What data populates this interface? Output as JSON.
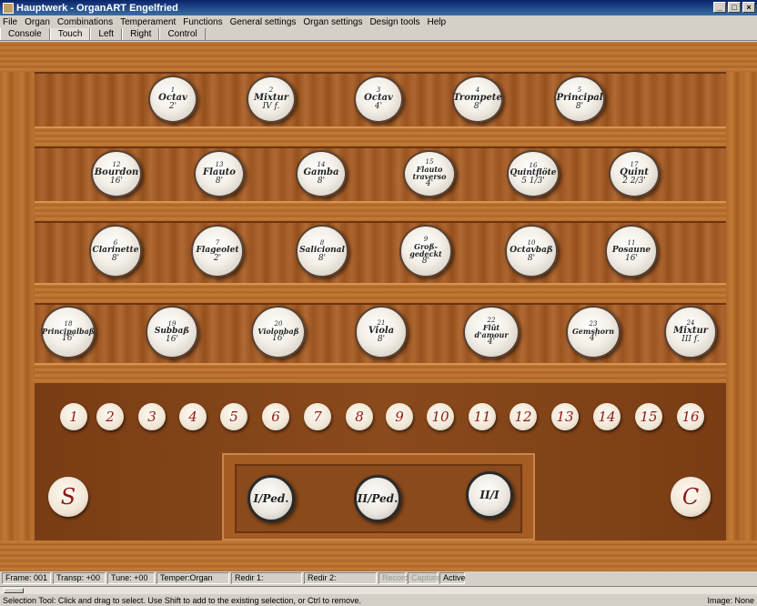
{
  "window": {
    "title": "Hauptwerk - OrganART Engelfried"
  },
  "menu": [
    "File",
    "Organ",
    "Combinations",
    "Temperament",
    "Functions",
    "General settings",
    "Organ settings",
    "Design tools",
    "Help"
  ],
  "tabs": [
    "Console",
    "Touch",
    "Left",
    "Right",
    "Control"
  ],
  "stops": [
    {
      "num": "1",
      "name": "Octav",
      "pitch": "2'"
    },
    {
      "num": "2",
      "name": "Mixtur",
      "pitch": "IV f."
    },
    {
      "num": "3",
      "name": "Octav",
      "pitch": "4'"
    },
    {
      "num": "4",
      "name": "Trompete",
      "pitch": "8'"
    },
    {
      "num": "5",
      "name": "Principal",
      "pitch": "8'"
    },
    {
      "num": "12",
      "name": "Bourdon",
      "pitch": "16'"
    },
    {
      "num": "13",
      "name": "Flauto",
      "pitch": "8'"
    },
    {
      "num": "14",
      "name": "Gamba",
      "pitch": "8'"
    },
    {
      "num": "15",
      "name": "Flauto traverso",
      "pitch": "4'"
    },
    {
      "num": "16",
      "name": "Quintflöte",
      "pitch": "5 1/3'"
    },
    {
      "num": "17",
      "name": "Quint",
      "pitch": "2 2/3'"
    },
    {
      "num": "6",
      "name": "Clarinette",
      "pitch": "8'"
    },
    {
      "num": "7",
      "name": "Flageolet",
      "pitch": "2'"
    },
    {
      "num": "8",
      "name": "Salicional",
      "pitch": "8'"
    },
    {
      "num": "9",
      "name": "Groß-gedeckt",
      "pitch": "8'"
    },
    {
      "num": "10",
      "name": "Octavbaß",
      "pitch": "8'"
    },
    {
      "num": "11",
      "name": "Posaune",
      "pitch": "16'"
    },
    {
      "num": "18",
      "name": "Principalbaß",
      "pitch": "16'"
    },
    {
      "num": "19",
      "name": "Subbaß",
      "pitch": "16'"
    },
    {
      "num": "20",
      "name": "Violonbaß",
      "pitch": "16'"
    },
    {
      "num": "21",
      "name": "Viola",
      "pitch": "8'"
    },
    {
      "num": "22",
      "name": "Flût d'amour",
      "pitch": "4'"
    },
    {
      "num": "23",
      "name": "Gemshorn",
      "pitch": "4'"
    },
    {
      "num": "24",
      "name": "Mixtur",
      "pitch": "III f."
    }
  ],
  "pistons": [
    "1",
    "2",
    "3",
    "4",
    "5",
    "6",
    "7",
    "8",
    "9",
    "10",
    "11",
    "12",
    "13",
    "14",
    "15",
    "16"
  ],
  "set_piston": "S",
  "cancel_piston": "C",
  "couplers": [
    "I/Ped.",
    "II/Ped.",
    "II/I"
  ],
  "status": {
    "frame": "Frame: 001",
    "transp": "Transp: +00",
    "tune": "Tune: +00",
    "temper": "Temper:Organ",
    "redir1": "Redir 1:",
    "redir2": "Redir 2:",
    "record": "Record",
    "capture": "Capture",
    "active": "Active"
  },
  "bottom": {
    "hint": "Selection Tool: Click and drag to select. Use Shift to add to the existing selection, or Ctrl to remove.",
    "image": "Image: None"
  }
}
